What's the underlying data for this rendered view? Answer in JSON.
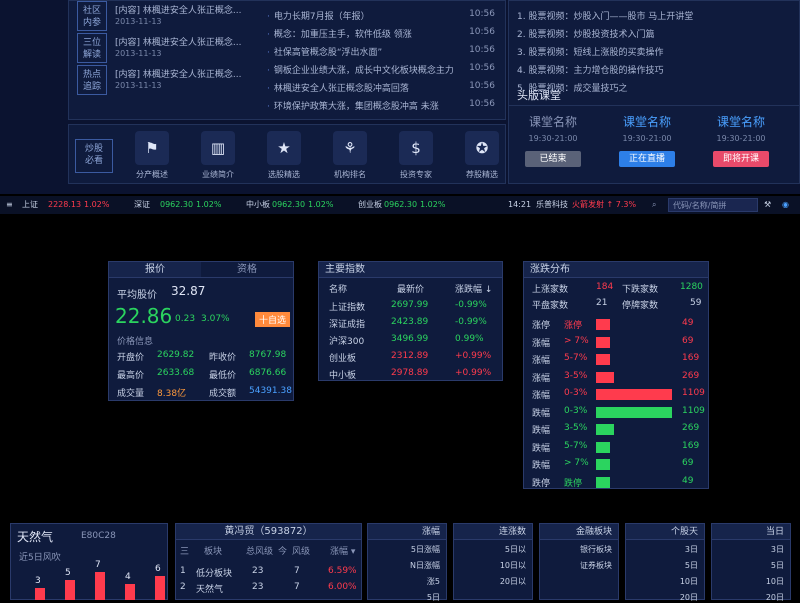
{
  "news": [
    {
      "tag": "社区\n内参",
      "title": "[内容] 林楓进安全人张正概念...",
      "date": "2013-11-13"
    },
    {
      "tag": "三位\n解读",
      "title": "[内容] 林楓进安全人张正概念...",
      "date": "2013-11-13"
    },
    {
      "tag": "热点\n追踪",
      "title": "[内容] 林楓进安全人张正概念...",
      "date": "2013-11-13"
    }
  ],
  "headlines": [
    {
      "text": "电力长期7月报（年报）",
      "time": "10:56"
    },
    {
      "text": "概念：加重压主手，软件低级 领涨",
      "time": "10:56"
    },
    {
      "text": "社保高管概念股“浮出水面”",
      "time": "10:56"
    },
    {
      "text": "钢板企业业绩大涨，成长中文化板块概念主力",
      "time": "10:56"
    },
    {
      "text": "林楓进安全人张正概念股冲高回落",
      "time": "10:56"
    },
    {
      "text": "环境保护政策大涨，集团概念股冲高 未涨",
      "time": "10:56"
    }
  ],
  "icons": [
    {
      "name": "flag-icon",
      "glyph": "⚑",
      "label": "分产概述"
    },
    {
      "name": "bar-chart-icon",
      "glyph": "▥",
      "label": "业绩简介"
    },
    {
      "name": "star-icon",
      "glyph": "★",
      "label": "选股精选"
    },
    {
      "name": "badge-icon",
      "glyph": "⚘",
      "label": "机构排名"
    },
    {
      "name": "dollar-icon",
      "glyph": "$",
      "label": "投资专家"
    },
    {
      "name": "star-circle-icon",
      "glyph": "✪",
      "label": "荐股精选"
    }
  ],
  "right_list": [
    "1. 股票视频：炒股入门——股市 马上开讲堂",
    "2. 股票视频：炒股投资技术入门篇",
    "3. 股票视频：短线上涨股的买卖操作",
    "4. 股票视频：主力增仓股的操作技巧",
    "5. 股票视频：成交量技巧之"
  ],
  "classroom": {
    "title": "头版课堂",
    "lessons": [
      {
        "name": "课堂名称",
        "time": "19:30-21:00",
        "btn": "已结束",
        "color": "#5a6278"
      },
      {
        "name": "课堂名称",
        "time": "19:30-21:00",
        "btn": "正在直播",
        "color": "#2d7fe8"
      },
      {
        "name": "课堂名称",
        "time": "19:30-21:00",
        "btn": "即将开课",
        "color": "#e84a6a"
      }
    ]
  },
  "ticker": {
    "items": [
      {
        "name": "上证",
        "val": "2228.13",
        "chg": "1.02%",
        "color": "#ff3b4d"
      },
      {
        "name": "深证",
        "val": "0962.30",
        "chg": "1.02%",
        "color": "#2bd45f"
      },
      {
        "name": "中小板",
        "val": "0962.30",
        "chg": "1.02%",
        "color": "#2bd45f"
      },
      {
        "name": "创业板",
        "val": "0962.30",
        "chg": "1.02%",
        "color": "#2bd45f"
      }
    ],
    "time": "14:21",
    "stock": "乐普科技",
    "alert": "火箭发射 ↑ 7.3%",
    "search_placeholder": "代码/名称/简拼"
  },
  "price_panel": {
    "tabs": [
      "报价",
      "资格"
    ],
    "avg_label": "平均股价",
    "avg_val": "32.87",
    "price": "22.86",
    "change": "0.23",
    "pct": "3.07%",
    "add_btn": "十自选",
    "info_title": "价格信息",
    "rows": [
      {
        "l1": "开盘价",
        "v1": "2629.82",
        "l2": "昨收价",
        "v2": "8767.98"
      },
      {
        "l1": "最高价",
        "v1": "2633.68",
        "l2": "最低价",
        "v2": "6876.66"
      },
      {
        "l1": "成交量",
        "v1": "8.38亿",
        "l2": "成交额",
        "v2": "54391.38"
      }
    ]
  },
  "index_panel": {
    "title": "主要指数",
    "headers": [
      "名称",
      "最新价",
      "涨跌幅 ↓"
    ],
    "rows": [
      {
        "name": "上证指数",
        "price": "2697.99",
        "chg": "-0.99%",
        "color": "#2bd45f"
      },
      {
        "name": "深证成指",
        "price": "2423.89",
        "chg": "-0.99%",
        "color": "#2bd45f"
      },
      {
        "name": "沪深300",
        "price": "3496.99",
        "chg": "0.99%",
        "color": "#2bd45f"
      },
      {
        "name": "创业板",
        "price": "2312.89",
        "chg": "+0.99%",
        "color": "#ff3b4d"
      },
      {
        "name": "中小板",
        "price": "2978.89",
        "chg": "+0.99%",
        "color": "#ff3b4d"
      }
    ]
  },
  "dist_panel": {
    "title": "涨跌分布",
    "up_label": "上涨家数",
    "up_val": "184",
    "down_label": "下跌家数",
    "down_val": "1280",
    "flat_label": "平盘家数",
    "flat_val": "21",
    "stop_label": "停牌家数",
    "stop_val": "59",
    "bars": [
      {
        "label": "涨停",
        "range": "涨停",
        "value": 49,
        "color": "#ff3b4d"
      },
      {
        "label": "涨幅",
        "range": "> 7%",
        "value": 69,
        "color": "#ff3b4d"
      },
      {
        "label": "涨幅",
        "range": "5-7%",
        "value": 169,
        "color": "#ff3b4d"
      },
      {
        "label": "涨幅",
        "range": "3-5%",
        "value": 269,
        "color": "#ff3b4d"
      },
      {
        "label": "涨幅",
        "range": "0-3%",
        "value": 1109,
        "color": "#ff3b4d"
      },
      {
        "label": "跌幅",
        "range": "0-3%",
        "value": 1109,
        "color": "#2bd45f"
      },
      {
        "label": "跌幅",
        "range": "3-5%",
        "value": 269,
        "color": "#2bd45f"
      },
      {
        "label": "跌幅",
        "range": "5-7%",
        "value": 169,
        "color": "#2bd45f"
      },
      {
        "label": "跌幅",
        "range": "> 7%",
        "value": 69,
        "color": "#2bd45f"
      },
      {
        "label": "跌停",
        "range": "跌停",
        "value": 49,
        "color": "#2bd45f"
      }
    ]
  },
  "gas_panel": {
    "title": "天然气",
    "code": "E80C28",
    "sub": "近5日风吹",
    "values": [
      3,
      5,
      7,
      4,
      6
    ]
  },
  "stock_panel": {
    "title": "黄冯贸（593872）",
    "headers": [
      "三",
      "板块",
      "总风级",
      "今",
      "风级",
      "涨幅 ▾"
    ],
    "rows": [
      {
        "n": "1",
        "a": "低分板块",
        "b": "23",
        "c": "7",
        "d": "6.59%"
      },
      {
        "n": "2",
        "a": "天然气",
        "b": "23",
        "c": "7",
        "d": "6.00%"
      }
    ]
  },
  "mini_panels": [
    {
      "title": "涨幅",
      "items": [
        "5日涨幅",
        "N日涨幅",
        "涨5",
        "5日"
      ]
    },
    {
      "title": "连涨数",
      "items": [
        "5日以",
        "10日以",
        "20日以"
      ]
    },
    {
      "title": "金融板块",
      "items": [
        "银行板块",
        "证券板块"
      ]
    },
    {
      "title": "个股天",
      "items": [
        "3日",
        "5日",
        "10日",
        "20日"
      ]
    },
    {
      "title": "当日",
      "items": [
        "3日",
        "5日",
        "10日",
        "20日"
      ]
    }
  ]
}
